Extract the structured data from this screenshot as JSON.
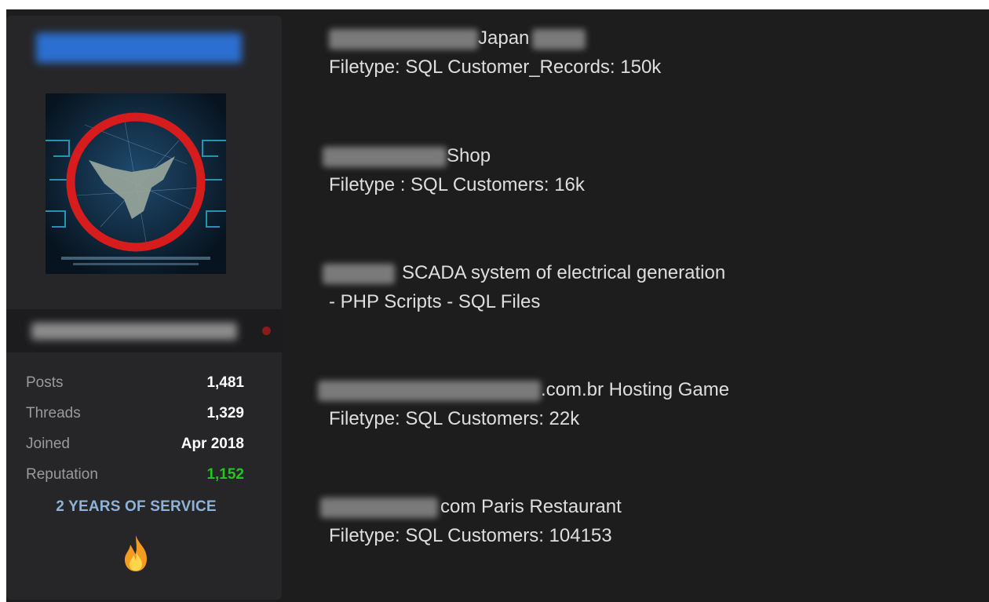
{
  "profile": {
    "stats": [
      {
        "label": "Posts",
        "value": "1,481",
        "color": "#ffffff"
      },
      {
        "label": "Threads",
        "value": "1,329",
        "color": "#ffffff"
      },
      {
        "label": "Joined",
        "value": "Apr 2018",
        "color": "#ffffff"
      },
      {
        "label": "Reputation",
        "value": "1,152",
        "color": "#23c423"
      }
    ],
    "service_badge": "2 YEARS OF SERVICE",
    "service_icon": "flame-icon",
    "status_color": "#8b1a1a",
    "name_color": "#2c6fd0",
    "avatar_icon": "eagle-emblem-icon"
  },
  "posts": [
    {
      "title": "Japan",
      "detail": "Filetype: SQL Customer_Records: 150k"
    },
    {
      "title": "Shop",
      "detail": "Filetype : SQL Customers: 16k"
    },
    {
      "title": "SCADA system of electrical generation",
      "detail": "- PHP Scripts - SQL Files"
    },
    {
      "title": ".com.br Hosting Game",
      "detail": "Filetype: SQL Customers: 22k"
    },
    {
      "title": "com Paris Restaurant",
      "detail": "Filetype: SQL Customers: 104153"
    }
  ]
}
